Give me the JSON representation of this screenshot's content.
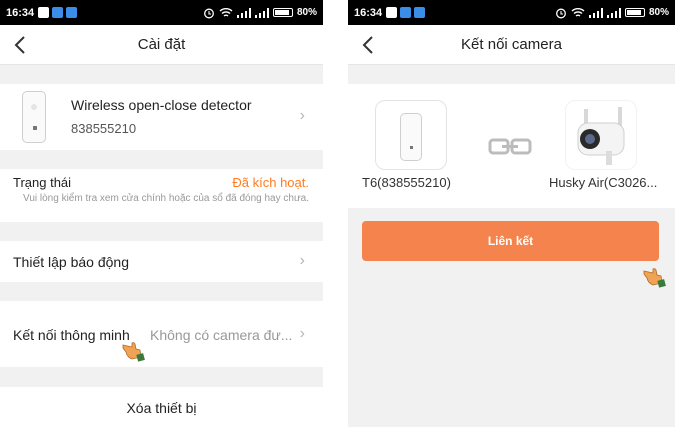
{
  "colors": {
    "accent": "#ff7b22",
    "button": "#f4834d",
    "background": "#f1f1f1",
    "statusbar": "#000000"
  },
  "left_screen": {
    "statusbar": {
      "time": "16:34",
      "battery": "80%"
    },
    "header": {
      "title": "Cài đặt",
      "back_icon": "chevron-left-icon"
    },
    "device": {
      "name": "Wireless open-close detector",
      "serial": "838555210"
    },
    "status": {
      "label": "Trạng thái",
      "value": "Đã kích hoạt.",
      "hint": "Vui lòng kiểm tra xem cửa chính hoặc của sổ đã đóng hay chưa."
    },
    "alarm": {
      "label": "Thiết lập báo động"
    },
    "smart_link": {
      "label": "Kết nối thông minh",
      "value": "Không có camera đư..."
    },
    "delete": {
      "label": "Xóa thiết bị"
    }
  },
  "right_screen": {
    "statusbar": {
      "time": "16:34",
      "battery": "80%"
    },
    "header": {
      "title": "Kết nối camera",
      "back_icon": "chevron-left-icon"
    },
    "left_device": {
      "label": "T6(838555210)",
      "icon": "door-sensor-icon"
    },
    "right_device": {
      "label": "Husky Air(C3026...",
      "icon": "camera-icon"
    },
    "link_icon": "chain-link-icon",
    "connect_button": "Liên kết"
  }
}
